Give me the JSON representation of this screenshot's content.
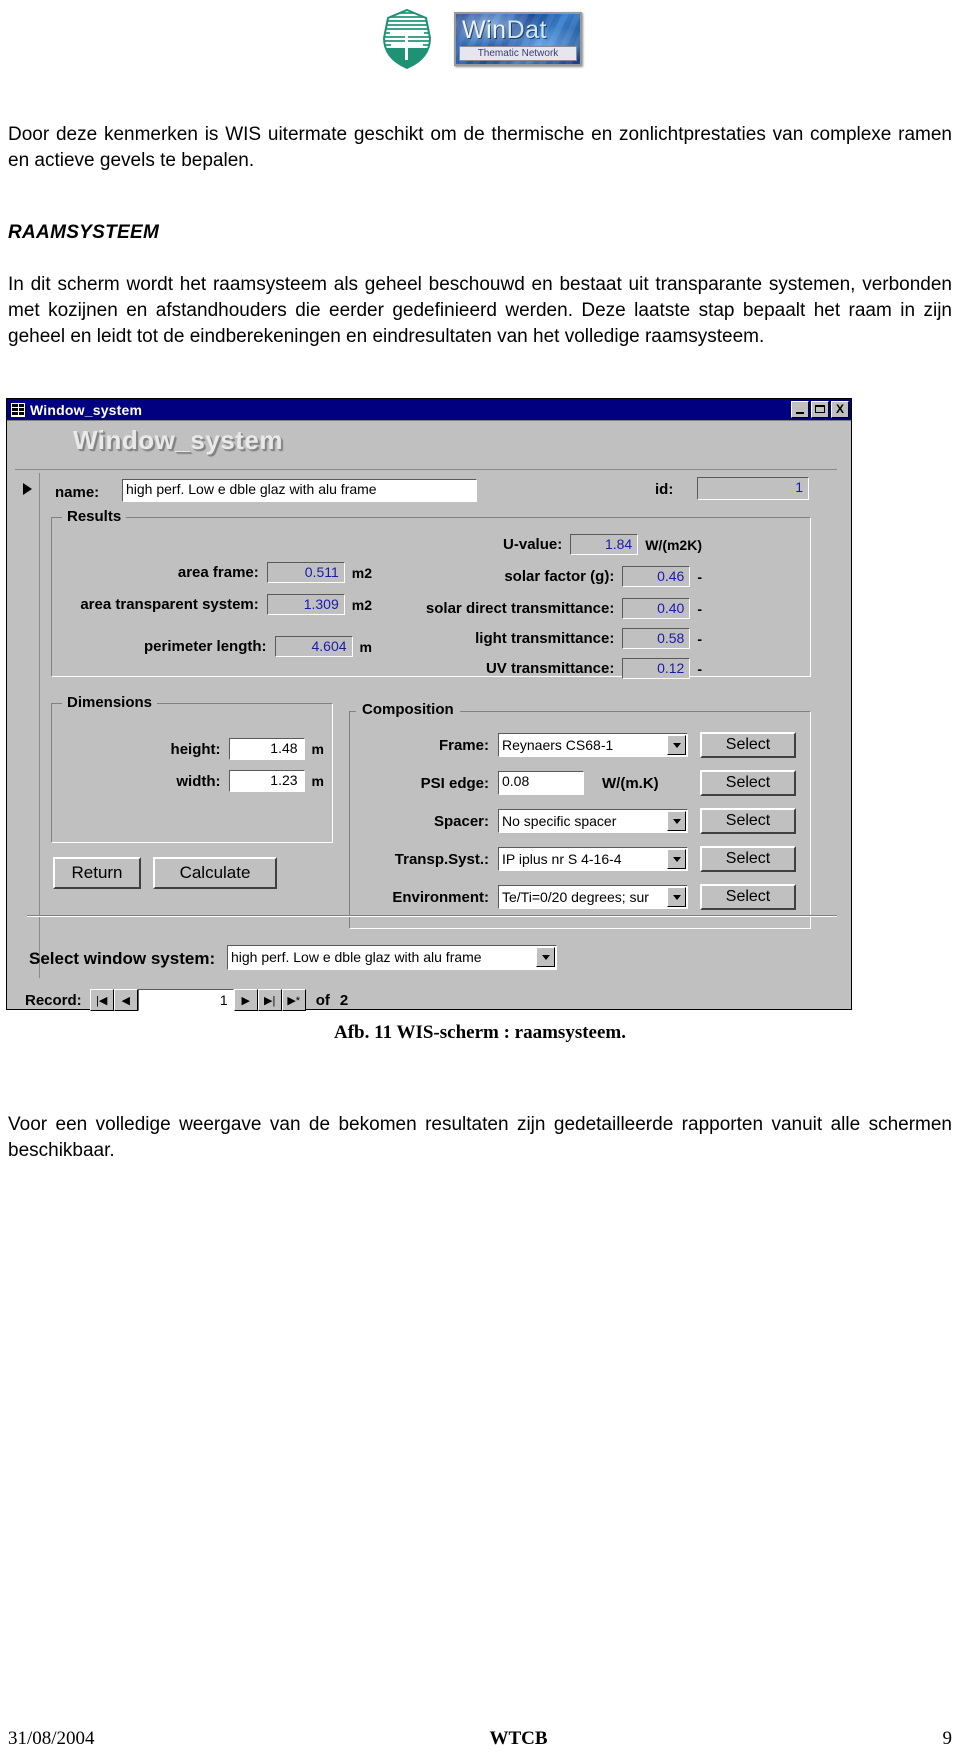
{
  "header": {
    "wtcb_logo_name": "wtcb-logo",
    "windat": {
      "title_win": "Win",
      "title_dat": "Dat",
      "subtitle": "Thematic Network"
    }
  },
  "document": {
    "intro_paragraph": "Door deze kenmerken is WIS uitermate geschikt om de thermische en zonlichtprestaties van complexe ramen en actieve gevels te bepalen.",
    "section_heading": "RAAMSYSTEEM",
    "section_paragraph": "In dit scherm wordt het raamsysteem als geheel beschouwd en bestaat uit transparante systemen, verbonden met kozijnen en afstandhouders die eerder gedefinieerd werden. Deze laatste stap bepaalt het raam in zijn geheel en leidt tot de eindberekeningen en eindresultaten van het volledige raamsysteem.",
    "figure_caption": "Afb. 11 WIS-scherm : raamsysteem.",
    "outro_paragraph": "Voor een volledige weergave van de bekomen resultaten zijn gedetailleerde rapporten vanuit alle schermen beschikbaar."
  },
  "app": {
    "titlebar": {
      "title": "Window_system",
      "minimize": "_",
      "maximize": "□",
      "close": "X"
    },
    "form_title": "Window_system",
    "name": {
      "label": "name:",
      "value": "high perf. Low e dble glaz with alu frame"
    },
    "id": {
      "label": "id:",
      "value": "1"
    },
    "results": {
      "title": "Results",
      "left": [
        {
          "label": "area frame:",
          "value": "0.511",
          "unit": "m2"
        },
        {
          "label": "area transparent system:",
          "value": "1.309",
          "unit": "m2"
        },
        {
          "label": "perimeter length:",
          "value": "4.604",
          "unit": "m"
        }
      ],
      "right": [
        {
          "label": "U-value:",
          "value": "1.84",
          "unit": "W/(m2K)"
        },
        {
          "label": "solar factor (g):",
          "value": "0.46",
          "unit": "-"
        },
        {
          "label": "solar direct transmittance:",
          "value": "0.40",
          "unit": "-"
        },
        {
          "label": "light transmittance:",
          "value": "0.58",
          "unit": "-"
        },
        {
          "label": "UV  transmittance:",
          "value": "0.12",
          "unit": "-"
        }
      ]
    },
    "dimensions": {
      "title": "Dimensions",
      "rows": [
        {
          "label": "height:",
          "value": "1.48",
          "unit": "m"
        },
        {
          "label": "width:",
          "value": "1.23",
          "unit": "m"
        }
      ]
    },
    "composition": {
      "title": "Composition",
      "select_button": "Select",
      "rows": [
        {
          "label": "Frame:",
          "value": "Reynaers CS68-1",
          "type": "combo",
          "unit": ""
        },
        {
          "label": "PSI edge:",
          "value": "0.08",
          "type": "text",
          "unit": "W/(m.K)"
        },
        {
          "label": "Spacer:",
          "value": "No specific spacer",
          "type": "combo",
          "unit": ""
        },
        {
          "label": "Transp.Syst.:",
          "value": "IP iplus nr S 4-16-4",
          "type": "combo",
          "unit": ""
        },
        {
          "label": "Environment:",
          "value": "Te/Ti=0/20 degrees; sur",
          "type": "combo",
          "unit": ""
        }
      ]
    },
    "buttons": {
      "return": "Return",
      "calculate": "Calculate"
    },
    "select_window_system": {
      "label": "Select window system:",
      "value": "high perf. Low e dble glaz with alu frame"
    },
    "record_bar": {
      "label": "Record:",
      "first": "|◀",
      "prev": "◀",
      "value": "1",
      "next": "▶",
      "last": "▶|",
      "new": "▶*",
      "of_label": "of",
      "total": "2"
    }
  },
  "footer": {
    "date": "31/08/2004",
    "center": "WTCB",
    "page": "9"
  }
}
